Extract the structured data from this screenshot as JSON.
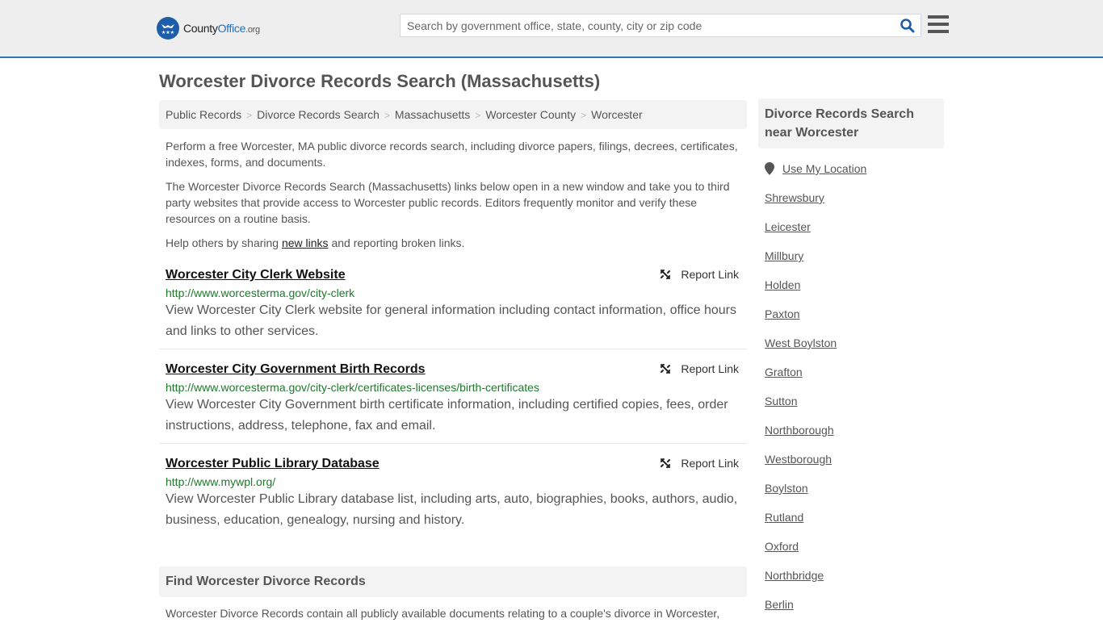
{
  "header": {
    "logo": {
      "part1": "County",
      "part2": "Office",
      "part3": ".org"
    },
    "search": {
      "placeholder": "Search by government office, state, county, city or zip code",
      "value": ""
    },
    "colors": {
      "accent": "#2c77b1",
      "brand": "#1e5ea8",
      "search_icon": "#1e5ea8"
    }
  },
  "page_title": "Worcester Divorce Records Search (Massachusetts)",
  "breadcrumb": [
    "Public Records",
    "Divorce Records Search",
    "Massachusetts",
    "Worcester County",
    "Worcester"
  ],
  "breadcrumb_separator": ">",
  "intro": {
    "p1": "Perform a free Worcester, MA public divorce records search, including divorce papers, filings, decrees, certificates, indexes, forms, and documents.",
    "p2": "The Worcester Divorce Records Search (Massachusetts) links below open in a new window and take you to third party websites that provide access to Worcester public records. Editors frequently monitor and verify these resources on a routine basis.",
    "p3_before": "Help others by sharing ",
    "p3_link": "new links",
    "p3_after": " and reporting broken links."
  },
  "report_label": "Report Link",
  "results": [
    {
      "title": "Worcester City Clerk Website",
      "url": "http://www.worcesterma.gov/city-clerk",
      "description": "View Worcester City Clerk website for general information including contact information, office hours and links to other services."
    },
    {
      "title": "Worcester City Government Birth Records",
      "url": "http://www.worcesterma.gov/city-clerk/certificates-licenses/birth-certificates",
      "description": "View Worcester City Government birth certificate information, including certified copies, fees, order instructions, address, telephone, fax and email."
    },
    {
      "title": "Worcester Public Library Database",
      "url": "http://www.mywpl.org/",
      "description": "View Worcester Public Library database list, including arts, auto, biographies, books, authors, audio, business, education, genealogy, nursing and history."
    }
  ],
  "find_section": {
    "heading": "Find Worcester Divorce Records",
    "text": "Worcester Divorce Records contain all publicly available documents relating to a couple's divorce in Worcester,"
  },
  "sidebar": {
    "heading": "Divorce Records Search near Worcester",
    "use_location": "Use My Location",
    "places": [
      "Shrewsbury",
      "Leicester",
      "Millbury",
      "Holden",
      "Paxton",
      "West Boylston",
      "Grafton",
      "Sutton",
      "Northborough",
      "Westborough",
      "Boylston",
      "Rutland",
      "Oxford",
      "Northbridge",
      "Berlin"
    ]
  }
}
